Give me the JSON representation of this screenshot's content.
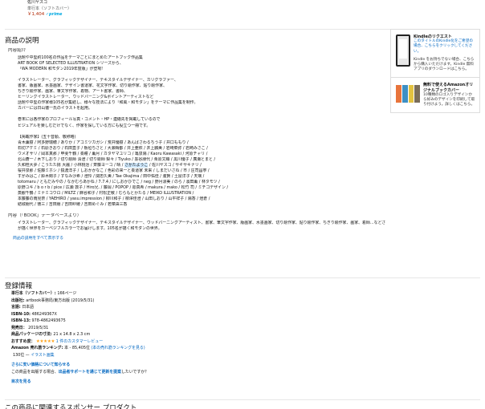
{
  "top": {
    "author": "佐川ヤスコ",
    "binding": "単行本（ソフトカバー）",
    "price": "￥1,404",
    "prime": "✓prime"
  },
  "description": {
    "heading": "商品の説明",
    "intro_heading": "内容紹介",
    "intro_lines": [
      "話題や中堅約100名の作品をテーマごとにまとめたアートブック作品集",
      "ART BOOK OF SELECTED ILLUSTRATION シリーズから、",
      "「WA MODERN 和モダン2019年度版」が登場!"
    ],
    "body_lines": [
      "イラストレーター、グラフィックデザイナー、テキスタイルデザイナー、カリグラファー、",
      "書家、版画家、水墨画家、デザイン書道家、花文字作家、切り絵作家、貼り絵作家、",
      "ちぎり絵作家、画家、筆文字作家、着物、アート書家、書師、",
      "ヒーリングイラストレーター、ウッドバーニング&ポイントアーティストなど",
      "話題や中堅の作家様105名が集結し、様々な技法により「和風・和モダン」をテーマに作品集を制作。",
      "カバーには日山徹一氏のイラストを起用。",
      "",
      "巻末には各作家のプロフィール写真・コメント・HP・連絡先を掲載しているので",
      "ビジュアルを楽しむだけでなく、作家を探している方にも役立つ一冊です。"
    ],
    "artists_heading": "【掲載作家】(五十音順、敬称略)",
    "artists_lines": [
      "青木薫樹 / 阿多野瑞穂 / ありか / アコミツカガシ / 荒井優樹 / あんばさわるちう子 / 井口ももり /",
      "石切アケミ / 石原きおり / 石田直子 / 板垣ちさと / 大瀬晴都 / 井上亜依 / 井上鵬美 / 岩崎菜弥 / 岩崎みさこ /",
      "ウメオサリ / 岡本真那 / 甲斐千鶴 / 奏瞳 / 薫月 / カタヤマユリコ / 亀泉陽 / Kaoru Kawasaki / 河原チャリ /",
      "北山蒼一 / 木下しおり / 切り絵師 清澄 / 切り絵師 梨々 / Tiyuko / 墨谷朋代 / 栗原文織 / 黒川優子 / 廣瀬とまと /",
      "久和桂大夢 / こうたた揚 大麗 / 小林桃治 / 斉藤ヨーコ / 晴 / さかたようこ / 佐川ヤスコ / サギサキナリ /",
      "桜井泉那 / 佐藤ミホシ / 猿渡洋子 / しおかかなこ / 色彩の来ーと奏道家 未来 / しまだいさね / 市 / 庄司昌寧 /",
      "すがみはこ / 鈴木絢子 / すなみ沙希 / 澄怜 / 関忠久美 / Tae Okajima / 田中佑佳 / 瀧賢 / 土屋洋子 / 天璃 /",
      "totomaru / ともだみやの / なかむらあかね / 7.7.4 / にしおかひでこ / neg / 野月涼美 / のら / 濱田薫 / 林タモツ /",
      "原野ユキ / b o r b / pice / 広瀬 敦子 / Hiro兄. / 藤岡 / POPOP / 彫真希 / makura / mako / 松竹 司 / ミチゴデザイン /",
      "蒸観千鶴 / ミナミコウロ / MILTZ / 麻谷和子 / 村松正敏 / むらもとかたる / MEIKO ILLUSTRATION /",
      "本藤藤の雨見奈 / YAEHIRO / yasu.impression / 柳川和子 / 柳澤佳澄 / 山田しおり / 山平祥子 / 陽香 / 燈倉 /",
      "結城朋代 / 徳三 / 吉田朋 / 吉田紗綾 / 吉田めぐみ / 若菜由三香"
    ],
    "book_heading": "内容（「BOOK」データベースより）",
    "book_text_1": "イラストレーター、グラフィックデザイナー、テキスタイルデザイナー、ウッドバーニングアーティスト、書家、筆文字作家、版画家、水墨画家、切り絵作家、貼り絵作家、ちぎり絵作家、画家、着師…などさまざまなジャンルのアーティスト",
    "book_text_2": "が描く世界をカーベジフルカラーでお届けします。105名が描く和モダンの世界。",
    "all_link": "商品の説明をすべて表示する"
  },
  "sidebar": {
    "kindle_title": "Kindleのリクエスト",
    "kindle_text_1": "このタイトルのKindle化をご希望の場合、こちらをクリックしてください。",
    "kindle_text_2": "Kindle をお持ちでない場合、こちらから購入いただけます。Kindle 無料アプリのダウンロードはこちら。",
    "cover_title": "無料で使えるAmazonオリジナルブックカバー",
    "cover_text": "10種類のロゴ入りデザインから好みのデザインを印刷して取り付けよう。詳しくはこちら。",
    "cover_colors": [
      "#e8743b",
      "#3d8fc4",
      "#e3c240",
      "#7a6d5a"
    ]
  },
  "registration": {
    "heading": "登録情報",
    "rows": [
      {
        "label": "単行本（ソフトカバー）:",
        "value": "166ページ"
      },
      {
        "label": "出版社:",
        "value": "artbook事務局/東方出版 (2019/5/31)"
      },
      {
        "label": "言語:",
        "value": "日本語"
      },
      {
        "label": "ISBN-10:",
        "value": "486249367X"
      },
      {
        "label": "ISBN-13:",
        "value": "978-4862493675"
      },
      {
        "label": "発売日：",
        "value": "2019/5/31"
      },
      {
        "label": "商品パッケージの寸法:",
        "value": "21 x 14.8 x 2.3 cm"
      }
    ],
    "reviews_label": "おすすめ度：",
    "stars": "★★★★★",
    "reviews_link": "1 件のカスタマーレビュー",
    "rank_label": "Amazon 売れ筋ランキング:",
    "rank_value": "本 - 85,405位",
    "rank_link": "(本の売れ筋ランキングを見る)",
    "rank_sub_number": "130位",
    "rank_sub_link": "イラスト画集",
    "cheap_link": "さらに安い価格について知らせる",
    "publisher_text_1": "この商品を出版する場合、",
    "publisher_link": "出品者サポートを通じて更新を提案",
    "publisher_text_2": "したいですか？",
    "toc_link": "目次を見る"
  },
  "next_section": "この商品に関連するスポンサー プロダクト"
}
